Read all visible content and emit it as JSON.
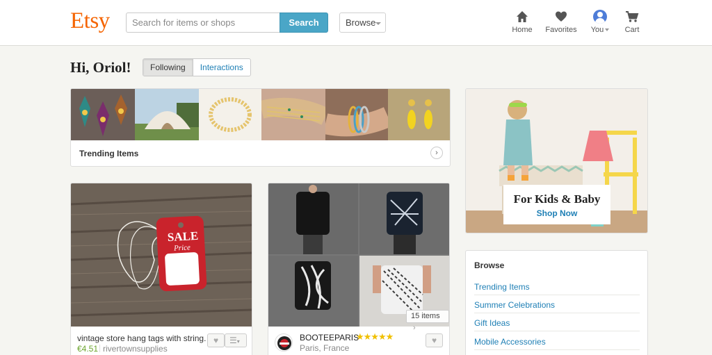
{
  "header": {
    "logo": "Etsy",
    "search_placeholder": "Search for items or shops",
    "search_button": "Search",
    "browse_label": "Browse",
    "nav": {
      "home": "Home",
      "favorites": "Favorites",
      "you": "You",
      "cart": "Cart"
    }
  },
  "greeting": "Hi, Oriol!",
  "toggle": {
    "following": "Following",
    "interactions": "Interactions"
  },
  "trending": {
    "label": "Trending Items"
  },
  "listing": {
    "title": "vintage store hang tags with string...",
    "price": "€4.51",
    "shop": "rivertownsupplies",
    "tag_text_1": "SALE",
    "tag_text_2": "Price"
  },
  "collection": {
    "shop_name": "BOOTEEPARIS",
    "stars": "★★★★★",
    "rating": 5,
    "location": "Paris, France",
    "items_count": "15 items"
  },
  "promo": {
    "title": "For Kids & Baby",
    "link": "Shop Now"
  },
  "browse_panel": {
    "title": "Browse",
    "items": [
      "Trending Items",
      "Summer Celebrations",
      "Gift Ideas",
      "Mobile Accessories"
    ]
  },
  "colors": {
    "brand": "#f56400",
    "search_button": "#4aa6c7",
    "link": "#1e7fb5",
    "price": "#6ba42d",
    "star": "#f0c000"
  }
}
